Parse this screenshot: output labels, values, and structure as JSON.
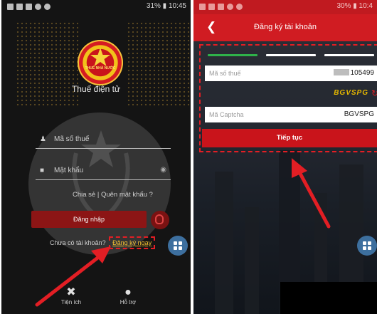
{
  "left_screen": {
    "status": {
      "text": "31% ▮ 10:45"
    },
    "emblem_text": "THUẾ NHÀ NƯỚC",
    "app_title": "Thuế điện tử",
    "tax_id_field": {
      "label": "Mã số thuế"
    },
    "password_field": {
      "label": "Mật khẩu"
    },
    "share_link": "Chia sẻ",
    "link_separator": "|",
    "forgot_link": "Quên mật khẩu ?",
    "login_button": "Đăng nhập",
    "no_account_text": "Chưa có tài khoản?",
    "register_link": "Đăng ký ngay",
    "bottom_nav": [
      {
        "label": "Tiện ích",
        "icon": "tools-icon"
      },
      {
        "label": "Hỗ trợ",
        "icon": "support-icon"
      }
    ]
  },
  "right_screen": {
    "status": {
      "text": "30% ▮ 10:4"
    },
    "header_title": "Đăng ký tài khoản",
    "steps": 3,
    "active_step": 1,
    "tax_id_field": {
      "placeholder": "Mã số thuế",
      "value_suffix": "105499"
    },
    "captcha_image_text": "BGVSPG",
    "captcha_field": {
      "placeholder": "Mã Captcha",
      "value": "BGVSPG"
    },
    "continue_button": "Tiếp tục"
  },
  "colors": {
    "accent_red": "#d01c22",
    "highlight_dashed": "#e31e24",
    "link_yellow": "#f5c233",
    "step_active": "#2fb24a",
    "fab_blue": "#3d6f9e"
  }
}
